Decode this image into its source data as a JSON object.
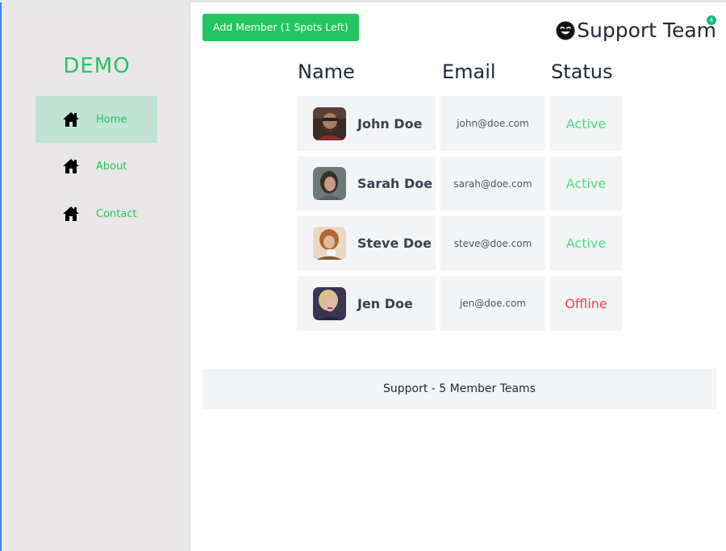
{
  "sidebar": {
    "brand": "DEMO",
    "items": [
      {
        "label": "Home",
        "icon": "home-icon",
        "active": true
      },
      {
        "label": "About",
        "icon": "home-icon",
        "active": false
      },
      {
        "label": "Contact",
        "icon": "home-icon",
        "active": false
      }
    ]
  },
  "header": {
    "add_button_label": "Add Member (1 Spots Left)",
    "team_title": "Support Team",
    "notification_count": "4"
  },
  "table": {
    "columns": [
      "Name",
      "Email",
      "Status"
    ],
    "rows": [
      {
        "name": "John Doe",
        "email": "john@doe.com",
        "status": "Active"
      },
      {
        "name": "Sarah Doe",
        "email": "sarah@doe.com",
        "status": "Active"
      },
      {
        "name": "Steve Doe",
        "email": "steve@doe.com",
        "status": "Active"
      },
      {
        "name": "Jen Doe",
        "email": "jen@doe.com",
        "status": "Offline"
      }
    ]
  },
  "footer": {
    "text": "Support - 5 Member Teams"
  },
  "colors": {
    "accent": "#22c55e",
    "active_status": "#4ade80",
    "offline_status": "#ef4444",
    "sidebar_bg": "#e9e7e8",
    "active_nav_bg": "#bfe3d4"
  }
}
